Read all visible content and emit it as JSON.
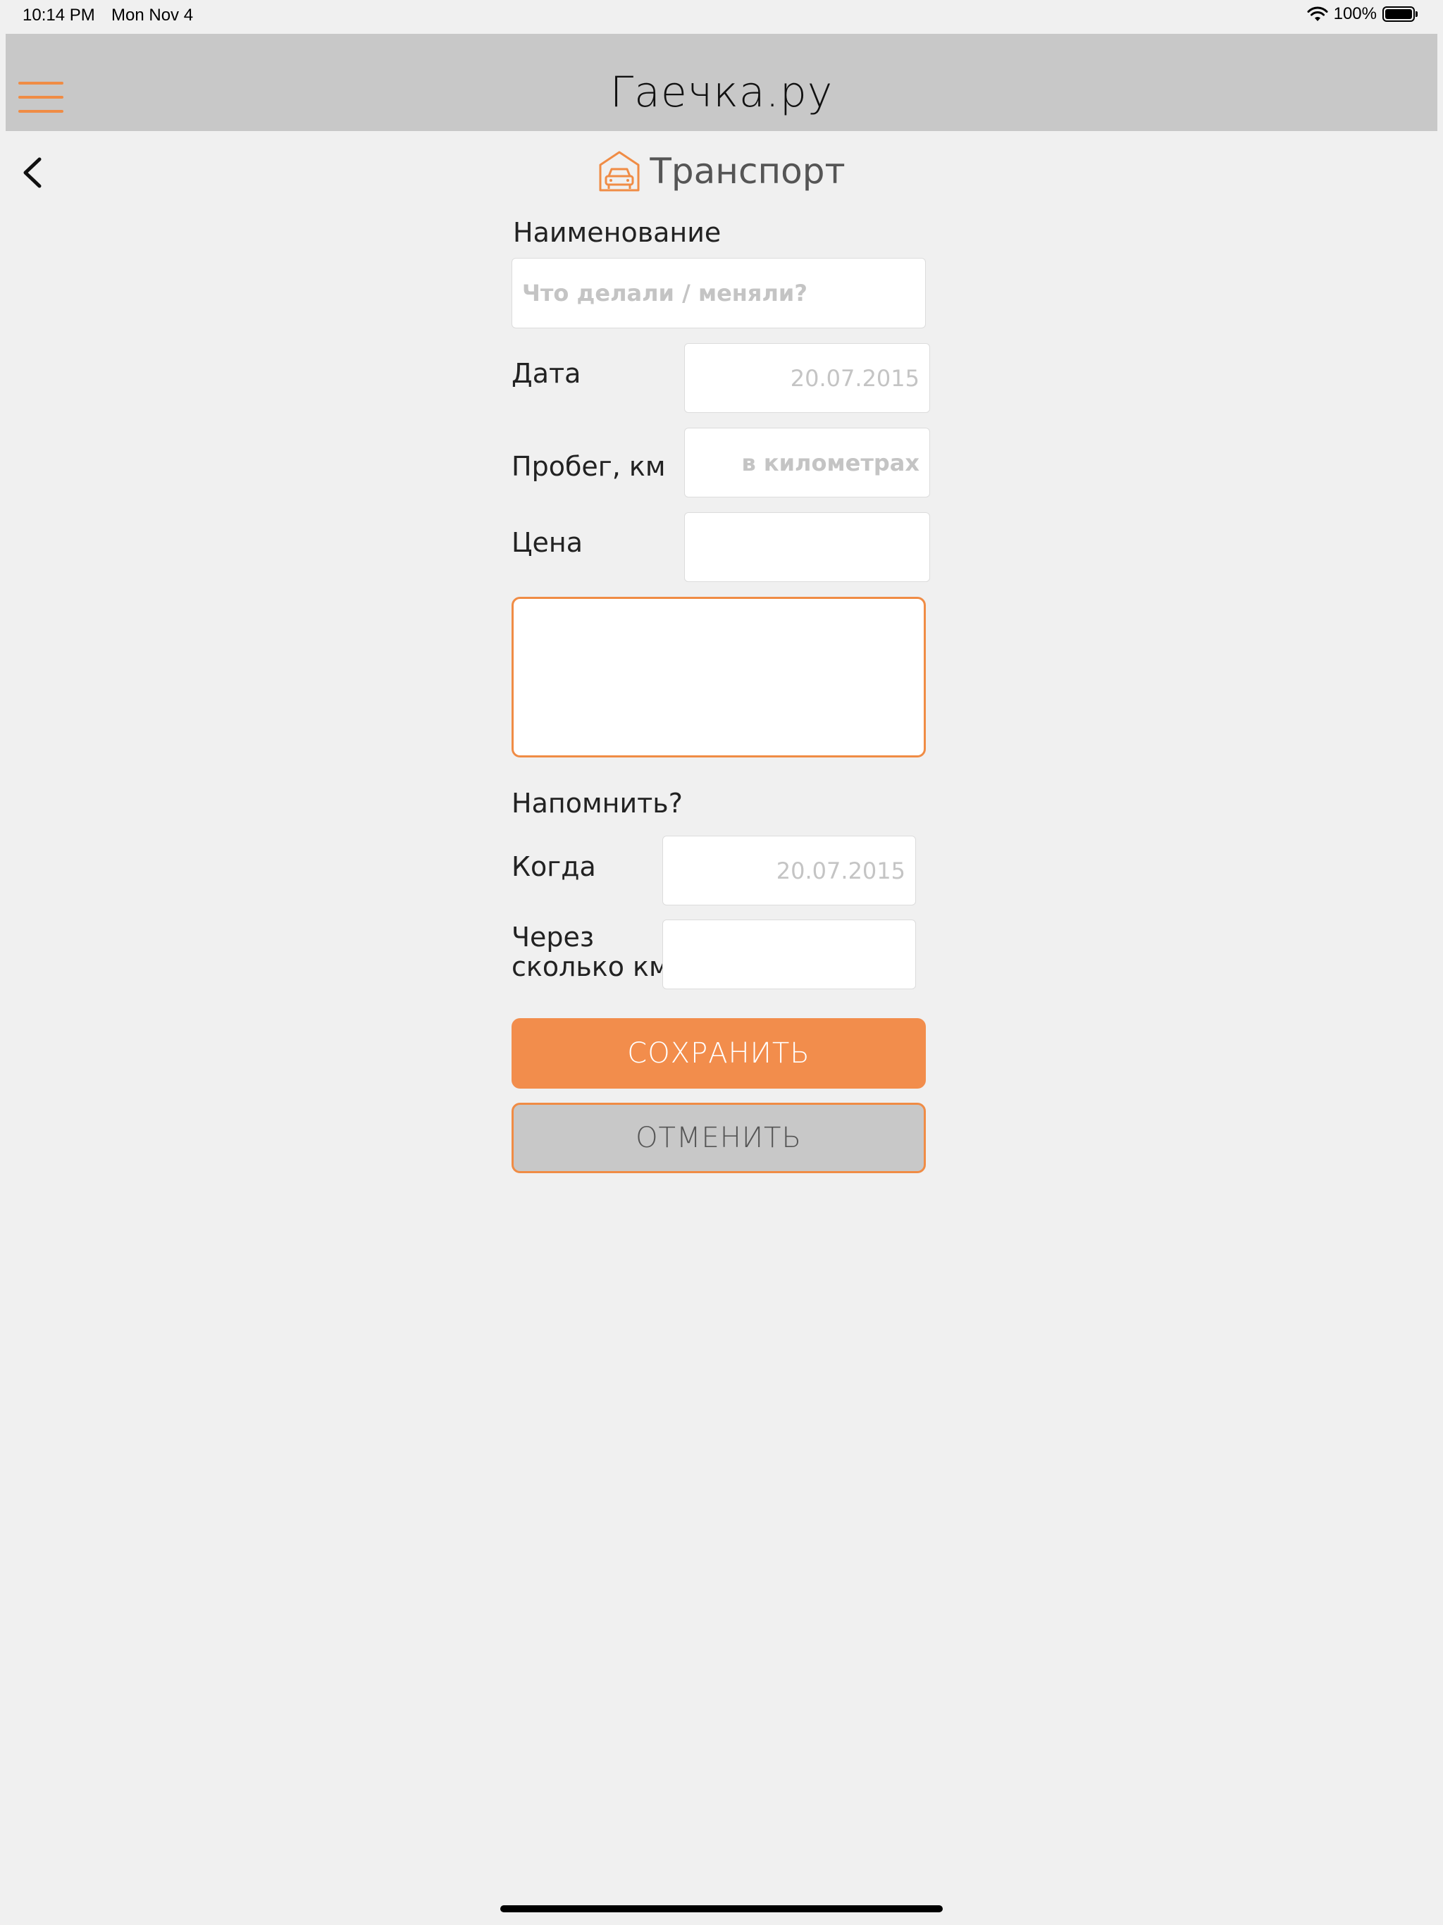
{
  "status_bar": {
    "time": "10:14 PM",
    "date": "Mon Nov 4",
    "battery": "100%"
  },
  "header": {
    "title": "Гаечка.ру",
    "menu_icon": "hamburger-menu-icon"
  },
  "section": {
    "title": "Транспорт",
    "icon": "garage-car-icon"
  },
  "form": {
    "name_label": "Наименование",
    "name_placeholder": "Что делали / меняли?",
    "date_label": "Дата",
    "date_placeholder": "20.07.2015",
    "mileage_label": "Пробег, км",
    "mileage_placeholder": "в километрах",
    "price_label": "Цена",
    "remind_label": "Напомнить?",
    "when_label": "Когда",
    "when_placeholder": "20.07.2015",
    "after_km_label_line1": "Через",
    "after_km_label_line2": "сколько км"
  },
  "buttons": {
    "save": "СОХРАНИТЬ",
    "cancel": "ОТМЕНИТЬ"
  },
  "colors": {
    "accent": "#f08c45",
    "header_bg": "#c8c8c8",
    "page_bg": "#f0f0f0"
  }
}
